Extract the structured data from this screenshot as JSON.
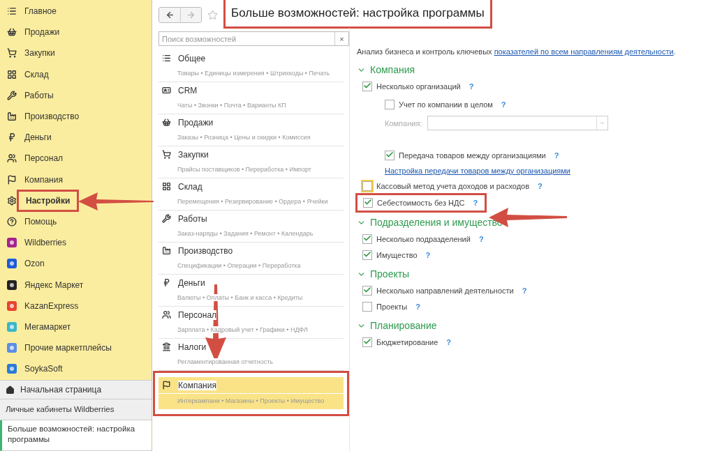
{
  "sidebar": {
    "items": [
      {
        "label": "Главное",
        "annotated": false
      },
      {
        "label": "Продажи",
        "annotated": false
      },
      {
        "label": "Закупки",
        "annotated": false
      },
      {
        "label": "Склад",
        "annotated": false
      },
      {
        "label": "Работы",
        "annotated": false
      },
      {
        "label": "Производство",
        "annotated": false
      },
      {
        "label": "Деньги",
        "annotated": false
      },
      {
        "label": "Персонал",
        "annotated": false
      },
      {
        "label": "Компания",
        "annotated": false
      },
      {
        "label": "Настройки",
        "annotated": true
      },
      {
        "label": "Помощь",
        "annotated": false
      },
      {
        "label": "Wildberries",
        "annotated": false
      },
      {
        "label": "Ozon",
        "annotated": false
      },
      {
        "label": "Яндекс Маркет",
        "annotated": false
      },
      {
        "label": "KazanExpress",
        "annotated": false
      },
      {
        "label": "Мегамаркет",
        "annotated": false
      },
      {
        "label": "Прочие маркетплейсы",
        "annotated": false
      },
      {
        "label": "SoykaSoft",
        "annotated": false
      }
    ],
    "home": "Начальная страница",
    "open_windows": [
      {
        "label": "Личные кабинеты Wildberries",
        "selected": false
      },
      {
        "label": "Больше возможностей: настройка программы",
        "selected": true
      }
    ]
  },
  "header": {
    "title": "Больше возможностей: настройка программы",
    "back_disabled": false,
    "forward_disabled": true
  },
  "search": {
    "placeholder": "Поиск возможностей",
    "clear": "×"
  },
  "sections": [
    {
      "title": "Общее",
      "subtitle": "Товары • Единицы измерения • Штрихкоды • Печать",
      "selected": false
    },
    {
      "title": "CRM",
      "subtitle": "Чаты • Звонки • Почта • Варианты КП",
      "selected": false
    },
    {
      "title": "Продажи",
      "subtitle": "Заказы • Розница • Цены и скидки • Комиссия",
      "selected": false
    },
    {
      "title": "Закупки",
      "subtitle": "Прайсы поставщиков • Переработка • Импорт",
      "selected": false
    },
    {
      "title": "Склад",
      "subtitle": "Перемещения • Резервирование • Ордера • Ячейки",
      "selected": false
    },
    {
      "title": "Работы",
      "subtitle": "Заказ-наряды • Задания • Ремонт • Календарь",
      "selected": false
    },
    {
      "title": "Производство",
      "subtitle": "Спецификации • Операции • Переработка",
      "selected": false
    },
    {
      "title": "Деньги",
      "subtitle": "Валюты • Оплаты • Банк и касса • Кредиты",
      "selected": false
    },
    {
      "title": "Персонал",
      "subtitle": "Зарплата • Кадровый учет • Графики • НДФЛ",
      "selected": false
    },
    {
      "title": "Налоги",
      "subtitle": "Регламентированная отчетность",
      "selected": false
    },
    {
      "title": "Компания",
      "subtitle": "Интеркампани • Магазины • Проекты • Имущество",
      "selected": true
    }
  ],
  "settings": {
    "intro": "Анализ бизнеса и контроль ключевых",
    "intro_link": "показателей по всем направлениям деятельности",
    "intro_end": ".",
    "groups": [
      {
        "title": "Компания",
        "expanded": true,
        "options": [
          {
            "kind": "checkbox",
            "label": "Несколько организаций",
            "checked": true,
            "help": "?",
            "focused": false,
            "annotated": false,
            "children": [
              {
                "kind": "checkbox",
                "label": "Учет по компании в целом",
                "checked": false,
                "help": "?",
                "focused": false,
                "annotated": false
              },
              {
                "kind": "field",
                "label": "Компания:",
                "disabled": true
              },
              {
                "kind": "checkbox",
                "label": "Передача товаров между организациями",
                "checked": true,
                "help": "?",
                "focused": false,
                "annotated": false
              },
              {
                "kind": "link",
                "label": "Настройка передачи товаров между организациями"
              }
            ]
          },
          {
            "kind": "checkbox",
            "label": "Кассовый метод учета доходов и расходов",
            "checked": false,
            "help": "?",
            "focused": true,
            "annotated": false
          },
          {
            "kind": "checkbox",
            "label": "Себестоимость без НДС",
            "checked": true,
            "help": "?",
            "focused": false,
            "annotated": true
          }
        ]
      },
      {
        "title": "Подразделения и имущество",
        "expanded": true,
        "options": [
          {
            "kind": "checkbox",
            "label": "Несколько подразделений",
            "checked": true,
            "help": "?",
            "focused": false,
            "annotated": false
          },
          {
            "kind": "checkbox",
            "label": "Имущество",
            "checked": true,
            "help": "?",
            "focused": false,
            "annotated": false
          }
        ]
      },
      {
        "title": "Проекты",
        "expanded": true,
        "options": [
          {
            "kind": "checkbox",
            "label": "Несколько направлений деятельности",
            "checked": true,
            "help": "?",
            "focused": false,
            "annotated": false
          },
          {
            "kind": "checkbox",
            "label": "Проекты",
            "checked": false,
            "help": "?",
            "focused": false,
            "annotated": false
          }
        ]
      },
      {
        "title": "Планирование",
        "expanded": true,
        "options": [
          {
            "kind": "checkbox",
            "label": "Бюджетирование",
            "checked": true,
            "help": "?",
            "focused": false,
            "annotated": false
          }
        ]
      }
    ]
  }
}
